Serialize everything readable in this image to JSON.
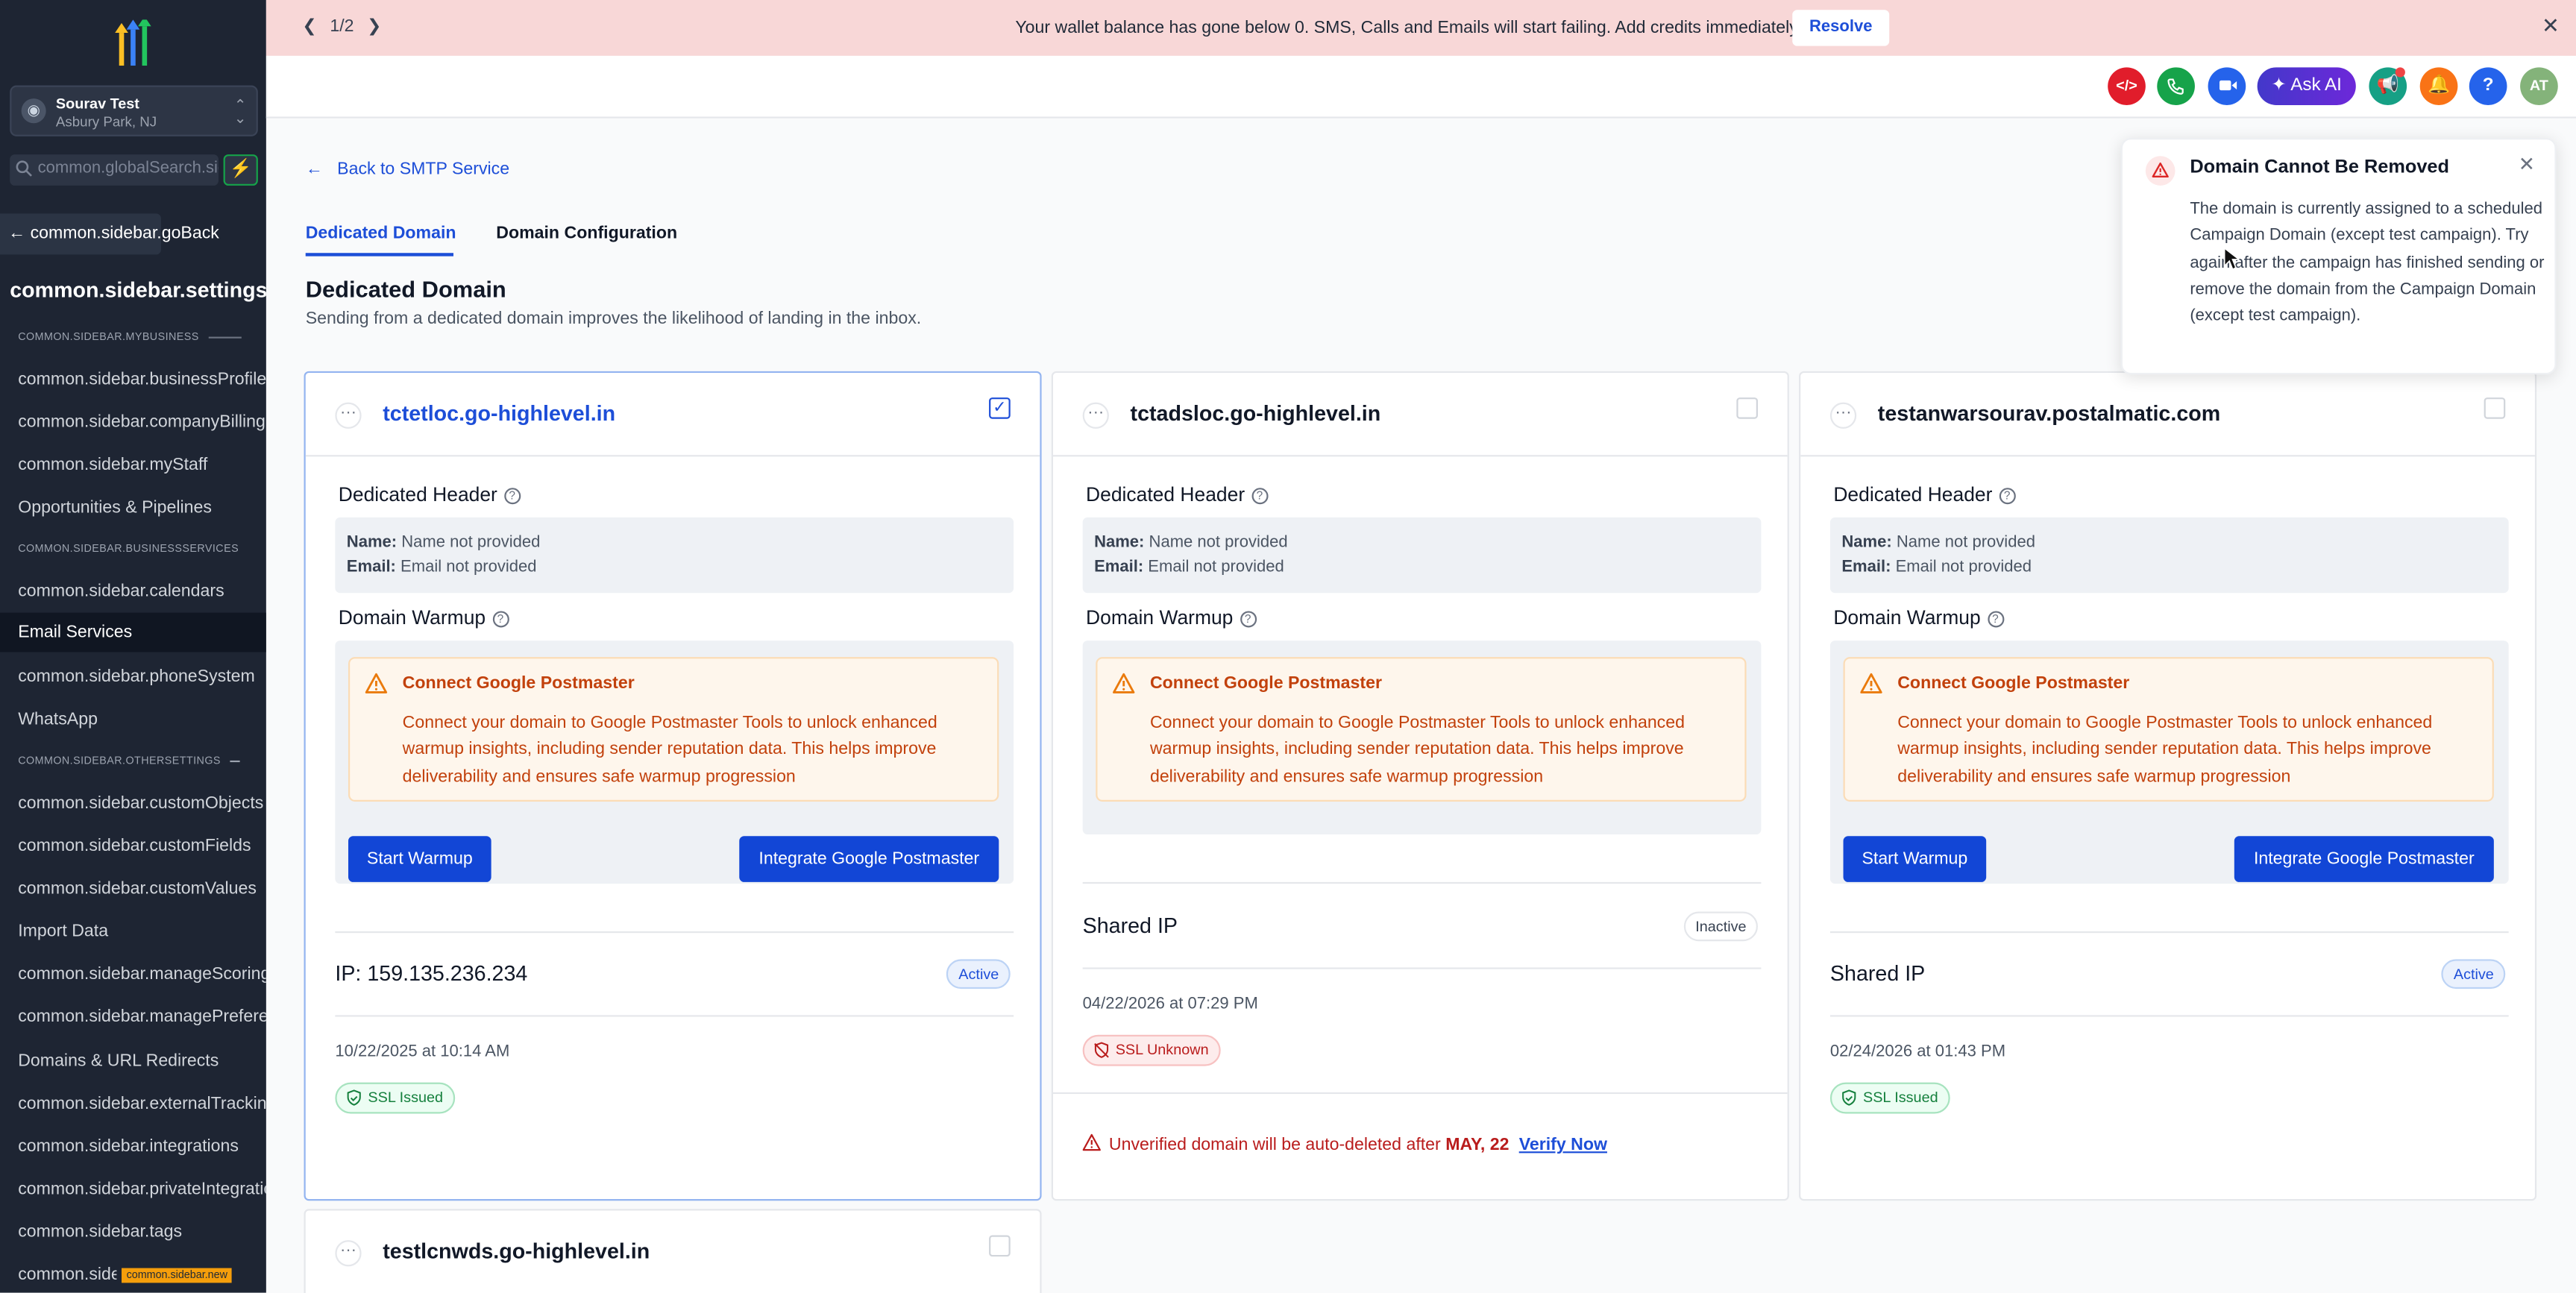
{
  "banner": {
    "pager": "1/2",
    "message": "Your wallet balance has gone below 0. SMS, Calls and Emails will start failing. Add credits immediately.",
    "resolve_label": "Resolve"
  },
  "topbar": {
    "ask_ai_label": "Ask AI",
    "help_label": "?",
    "avatar_initials": "AT",
    "code_label": "</>"
  },
  "sidebar": {
    "location_name": "Sourav Test",
    "location_address": "Asbury Park, NJ",
    "search_placeholder": "common.globalSearch.sidebar",
    "go_back": "common.sidebar.goBack",
    "settings_title": "common.sidebar.settings",
    "section_mybusiness": "COMMON.SIDEBAR.MYBUSINESS",
    "section_businessservices": "COMMON.SIDEBAR.BUSINESSSERVICES",
    "section_othersettings": "COMMON.SIDEBAR.OTHERSETTINGS",
    "items": [
      "common.sidebar.businessProfile",
      "common.sidebar.companyBilling",
      "common.sidebar.myStaff",
      "Opportunities & Pipelines",
      "common.sidebar.calendars",
      "Email Services",
      "common.sidebar.phoneSystem",
      "WhatsApp",
      "common.sidebar.customObjects",
      "common.sidebar.customFields",
      "common.sidebar.customValues",
      "Import Data",
      "common.sidebar.manageScoring",
      "common.sidebar.managePreferences",
      "Domains & URL Redirects",
      "common.sidebar.externalTracking",
      "common.sidebar.integrations",
      "common.sidebar.privateIntegrations",
      "common.sidebar.tags",
      "common.sidebar.labs"
    ],
    "new_badge": "common.sidebar.new"
  },
  "page": {
    "back_link": "Back to SMTP Service",
    "tabs": [
      "Dedicated Domain",
      "Domain Configuration"
    ],
    "title": "Dedicated Domain",
    "subtitle": "Sending from a dedicated domain improves the likelihood of landing in the inbox."
  },
  "labels": {
    "dedicated_header": "Dedicated Header",
    "domain_warmup": "Domain Warmup",
    "name_label": "Name:",
    "email_label": "Email:",
    "name_value": "Name not provided",
    "email_value": "Email not provided",
    "alert_title": "Connect Google Postmaster",
    "alert_body": "Connect your domain to Google Postmaster Tools to unlock enhanced warmup insights, including sender reputation data. This helps improve deliverability and ensures safe warmup progression",
    "start_warmup": "Start Warmup",
    "integrate_postmaster": "Integrate Google Postmaster"
  },
  "cards": [
    {
      "domain": "tctetloc.go-highlevel.in",
      "selected": true,
      "ip_label": "IP: 159.135.236.234",
      "status": "Active",
      "date": "10/22/2025 at 10:14 AM",
      "ssl": "SSL Issued"
    },
    {
      "domain": "tctadsloc.go-highlevel.in",
      "selected": false,
      "ip_label": "Shared IP",
      "status": "Inactive",
      "date": "04/22/2026 at 07:29 PM",
      "ssl": "SSL Unknown",
      "unverified_text": "Unverified domain will be auto-deleted after",
      "unverified_date": "MAY, 22",
      "verify_label": "Verify Now"
    },
    {
      "domain": "testanwarsourav.postalmatic.com",
      "selected": false,
      "ip_label": "Shared IP",
      "status": "Active",
      "date": "02/24/2026 at 01:43 PM",
      "ssl": "SSL Issued"
    },
    {
      "domain": "testlcnwds.go-highlevel.in",
      "selected": false
    }
  ],
  "toast": {
    "title": "Domain Cannot Be Removed",
    "body": "The domain is currently assigned to a scheduled Campaign Domain (except test campaign). Try again after the campaign has finished sending or remove the domain from the Campaign Domain (except test campaign)."
  },
  "colors": {
    "primary": "#1246d6",
    "sidebar_bg": "#1e2533",
    "banner_bg": "#f8d7d7",
    "warning": "#c2410c",
    "success": "#15803d",
    "danger": "#b91c1c"
  },
  "icons": [
    "search-icon",
    "plus-icon",
    "back-arrow-icon",
    "chevron-left-icon",
    "chevron-right-icon",
    "close-icon",
    "code-icon",
    "phone-icon",
    "video-icon",
    "sparkle-icon",
    "megaphone-icon",
    "bell-icon",
    "help-icon",
    "more-icon",
    "help-circle-icon",
    "warning-icon",
    "shield-check-icon",
    "shield-off-icon",
    "alert-triangle-icon"
  ]
}
